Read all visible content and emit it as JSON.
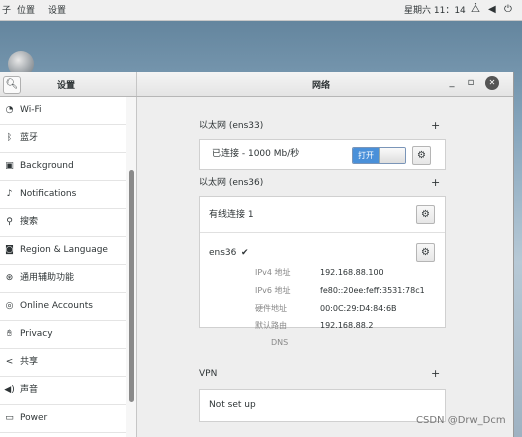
{
  "topbar": {
    "menu_partial": "子",
    "menu_location": "位置",
    "menu_settings": "设置",
    "clock": "星期六 11：14",
    "icons": [
      "network-icon",
      "volume-icon",
      "power-icon"
    ]
  },
  "header": {
    "settings_title": "设置",
    "panel_title": "网络"
  },
  "sidebar": {
    "items": [
      {
        "label": "Wi-Fi",
        "icon": "wifi-icon"
      },
      {
        "label": "蓝牙",
        "icon": "bluetooth-icon"
      },
      {
        "label": "Background",
        "icon": "background-icon"
      },
      {
        "label": "Notifications",
        "icon": "bell-icon"
      },
      {
        "label": "搜索",
        "icon": "search-icon"
      },
      {
        "label": "Region & Language",
        "icon": "camera-icon"
      },
      {
        "label": "通用辅助功能",
        "icon": "accessibility-icon"
      },
      {
        "label": "Online Accounts",
        "icon": "online-accounts-icon"
      },
      {
        "label": "Privacy",
        "icon": "hand-icon"
      },
      {
        "label": "共享",
        "icon": "share-icon"
      },
      {
        "label": "声音",
        "icon": "speaker-icon"
      },
      {
        "label": "Power",
        "icon": "power-icon"
      }
    ]
  },
  "main": {
    "ens33": {
      "title": "以太网 (ens33)",
      "status": "已连接 - 1000 Mb/秒",
      "toggle_label": "打开"
    },
    "ens36": {
      "title": "以太网 (ens36)",
      "wired_label": "有线连接 1",
      "device_name": "ens36",
      "details": [
        {
          "label": "IPv4 地址",
          "value": "192.168.88.100"
        },
        {
          "label": "IPv6 地址",
          "value": "fe80::20ee:feff:3531:78c1"
        },
        {
          "label": "硬件地址",
          "value": "00:0C:29:D4:84:6B"
        },
        {
          "label": "默认路由",
          "value": "192.168.88.2"
        },
        {
          "label": "DNS",
          "value": ""
        }
      ]
    },
    "vpn": {
      "title": "VPN",
      "status": "Not set up"
    }
  },
  "watermark": "CSDN @Drw_Dcm"
}
